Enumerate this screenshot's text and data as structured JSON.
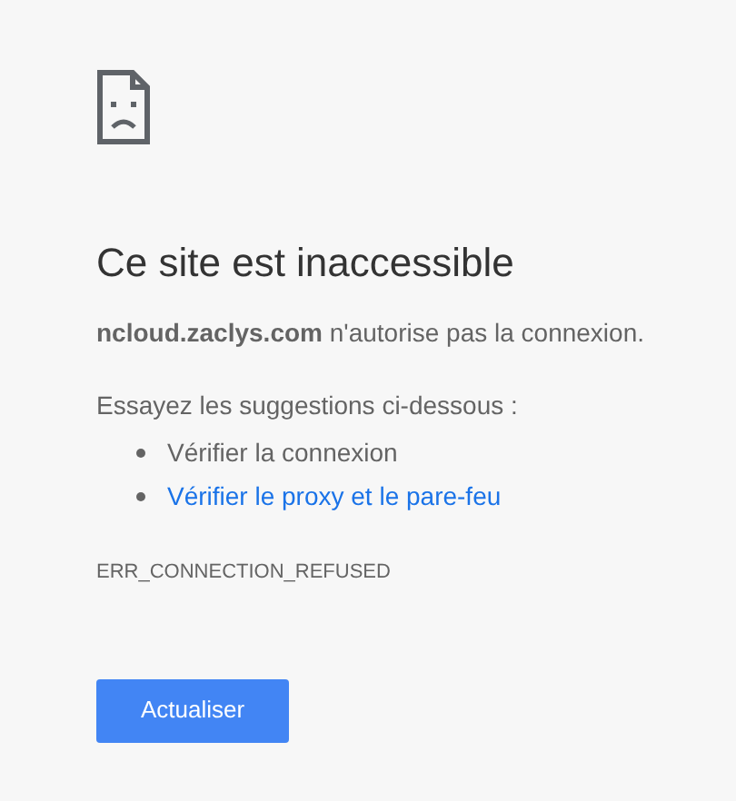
{
  "title": "Ce site est inaccessible",
  "message": "**ncloud.zaclys.com** n'autorise pas la connexion.",
  "suggestions_heading": "Essayez les suggestions ci-dessous :",
  "suggestions": [
    {
      "text": "Vérifier la connexion",
      "kind": "text"
    },
    {
      "text": "Vérifier le proxy et le pare-feu",
      "kind": "link"
    }
  ],
  "error_code": "ERR_CONNECTION_REFUSED",
  "button": "Actualiser"
}
